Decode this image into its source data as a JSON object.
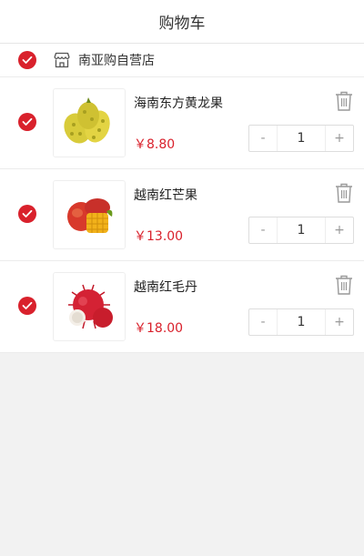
{
  "header": {
    "title": "购物车"
  },
  "shop": {
    "name": "南亚购自营店"
  },
  "items": [
    {
      "name": "海南东方黄龙果",
      "price": "￥8.80",
      "quantity": "1",
      "image": "dragon-fruit-image"
    },
    {
      "name": "越南红芒果",
      "price": "￥13.00",
      "quantity": "1",
      "image": "mango-image"
    },
    {
      "name": "越南红毛丹",
      "price": "￥18.00",
      "quantity": "1",
      "image": "rambutan-image"
    }
  ],
  "stepper": {
    "minus": "-",
    "plus": "+"
  },
  "colors": {
    "accent": "#d9212c",
    "background": "#f2f2f2"
  }
}
